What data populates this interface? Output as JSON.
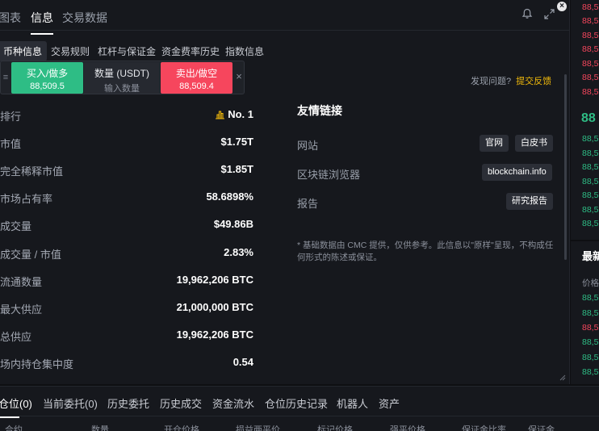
{
  "top_tabs": [
    {
      "label": "图表"
    },
    {
      "label": "信息"
    },
    {
      "label": "交易数据"
    }
  ],
  "sub_tabs": [
    {
      "label": "币种信息"
    },
    {
      "label": "交易规则"
    },
    {
      "label": "杠杆与保证金"
    },
    {
      "label": "资金费率历史"
    },
    {
      "label": "指数信息"
    }
  ],
  "trade_widget": {
    "buy_label": "买入/做多",
    "buy_price": "88,509.5",
    "qty_label": "数量 (USDT)",
    "qty_placeholder": "输入数量",
    "sell_label": "卖出/做空",
    "sell_price": "88,509.4"
  },
  "stats": [
    {
      "label": "排行",
      "value": "No. 1"
    },
    {
      "label": "市值",
      "value": "$1.75T"
    },
    {
      "label": "完全稀释市值",
      "value": "$1.85T"
    },
    {
      "label": "市场占有率",
      "value": "58.6898%"
    },
    {
      "label": "成交量",
      "value": "$49.86B"
    },
    {
      "label": "成交量 / 市值",
      "value": "2.83%"
    },
    {
      "label": "流通数量",
      "value": "19,962,206 BTC"
    },
    {
      "label": "最大供应",
      "value": "21,000,000 BTC"
    },
    {
      "label": "总供应",
      "value": "19,962,206 BTC"
    },
    {
      "label": "场内持仓集中度",
      "value": "0.54"
    }
  ],
  "feedback": {
    "question": "发现问题?",
    "link": "提交反馈"
  },
  "links": {
    "title": "友情链接",
    "website_label": "网站",
    "official": "官网",
    "whitepaper": "白皮书",
    "explorer_label": "区块链浏览器",
    "explorer": "blockchain.info",
    "report_label": "报告",
    "research": "研究报告"
  },
  "disclaimer": "* 基础数据由 CMC 提供，仅供参考。此信息以\"原样\"呈现，不构成任何形式的陈述或保证。",
  "right_strip": {
    "red_prices": [
      "88,5",
      "88,5",
      "88,5",
      "88,5",
      "88,5",
      "88,5",
      "88,5"
    ],
    "big_price": "88",
    "green_prices": [
      "88,5",
      "88,5",
      "88,5",
      "88,5",
      "88,5",
      "88,5",
      "88,5"
    ],
    "panel_title": "最新",
    "col_header": "价格",
    "trade_prices": [
      "88,5",
      "88,5",
      "88,5",
      "88,5",
      "88,5",
      "88,5"
    ]
  },
  "bottom_tabs": [
    {
      "label": "仓位(0)"
    },
    {
      "label": "当前委托(0)"
    },
    {
      "label": "历史委托"
    },
    {
      "label": "历史成交"
    },
    {
      "label": "资金流水"
    },
    {
      "label": "仓位历史记录"
    },
    {
      "label": "机器人"
    },
    {
      "label": "资产"
    }
  ],
  "columns": [
    "合约",
    "数量",
    "开仓价格",
    "损益两平价",
    "标记价格",
    "强平价格",
    "保证金比率",
    "保证金"
  ],
  "colors": {
    "buy": "#2ebd85",
    "sell": "#f6465d",
    "accent": "#f0b90b"
  }
}
